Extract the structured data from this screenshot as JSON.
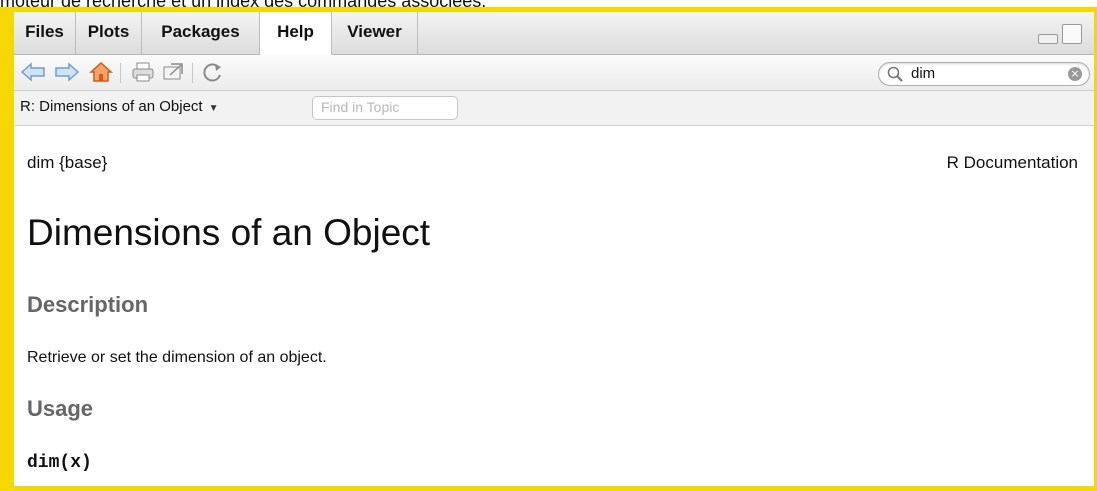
{
  "caption": "moteur de recherche et un index des commandes associées.",
  "tabs": [
    {
      "label": "Files"
    },
    {
      "label": "Plots"
    },
    {
      "label": "Packages"
    },
    {
      "label": "Help"
    },
    {
      "label": "Viewer"
    }
  ],
  "active_tab": "Help",
  "toolbar": {
    "icons": [
      "back-arrow-icon",
      "forward-arrow-icon",
      "home-icon",
      "print-icon",
      "new-window-icon",
      "refresh-icon"
    ]
  },
  "search": {
    "value": "dim"
  },
  "topic": {
    "title": "R: Dimensions of an Object",
    "find_placeholder": "Find in Topic"
  },
  "doc": {
    "header_left": "dim {base}",
    "header_right": "R Documentation",
    "title": "Dimensions of an Object",
    "sections": {
      "description_heading": "Description",
      "description_text": "Retrieve or set the dimension of an object.",
      "usage_heading": "Usage",
      "usage_code": "dim(x)"
    }
  },
  "colors": {
    "frame": "#f5d800",
    "heading_gray": "#666666",
    "home_icon": "#e86a10",
    "arrow_icon": "#7aaed8"
  }
}
